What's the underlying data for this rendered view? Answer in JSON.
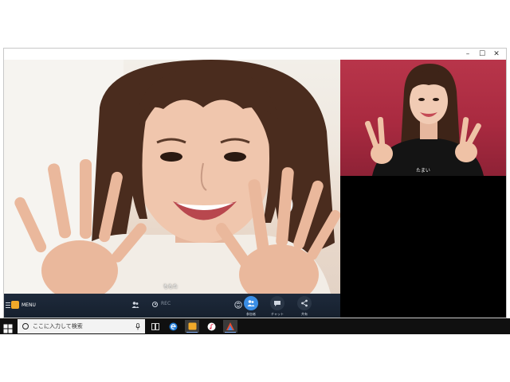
{
  "window": {
    "controls": {
      "minimize": "–",
      "maximize": "☐",
      "close": "✕"
    }
  },
  "participants": {
    "main": {
      "name": "ももた"
    },
    "side": {
      "name": "たまい"
    }
  },
  "toolbar": {
    "menu_label": "MENU",
    "rec_label": "REC",
    "participants_label": "参加者",
    "chat_label": "チャット",
    "share_label": "共有"
  },
  "taskbar": {
    "search_placeholder": "ここに入力して検索"
  },
  "colors": {
    "toolbar_bg": "#1e2a3b",
    "accent": "#3a8ee6",
    "taskbar_bg": "#101010",
    "side_bg": "#b8354a"
  }
}
